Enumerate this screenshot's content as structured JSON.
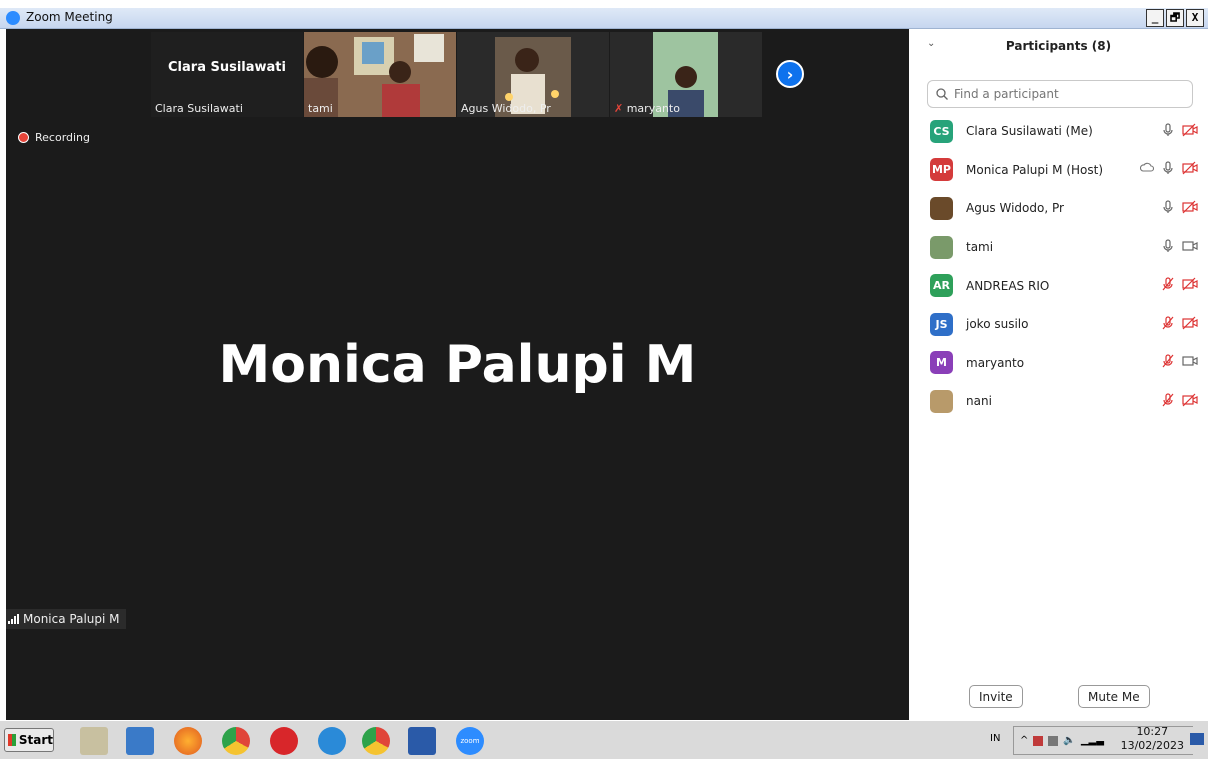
{
  "window": {
    "title": "Zoom Meeting",
    "minimize": "_",
    "restore": "🗗",
    "close": "X"
  },
  "strip": {
    "speaker": "Clara Susilawati",
    "tiles": [
      {
        "label": "Clara Susilawati"
      },
      {
        "label": "tami"
      },
      {
        "label": "Agus Widodo, Pr"
      },
      {
        "label": "maryanto"
      }
    ]
  },
  "recording": "Recording",
  "main_speaker": "Monica Palupi M",
  "bottom_name": "Monica Palupi M",
  "participants": {
    "title": "Participants (8)",
    "search_placeholder": "Find a participant",
    "list": [
      {
        "initials": "CS",
        "name": "Clara Susilawati (Me)",
        "color": "#27a37a",
        "mic": "on",
        "video": "off"
      },
      {
        "initials": "MP",
        "name": "Monica Palupi M (Host)",
        "color": "#d43b3b",
        "mic": "on",
        "video": "off",
        "sharing": true
      },
      {
        "initials": "",
        "name": "Agus Widodo, Pr",
        "color": "#6a4a2a",
        "mic": "on",
        "video": "off"
      },
      {
        "initials": "",
        "name": "tami",
        "color": "#7a9a6a",
        "mic": "on",
        "video": "on"
      },
      {
        "initials": "AR",
        "name": "ANDREAS RIO",
        "color": "#2ea05a",
        "mic": "off",
        "video": "off"
      },
      {
        "initials": "JS",
        "name": "joko susilo",
        "color": "#2f6fc8",
        "mic": "off",
        "video": "off"
      },
      {
        "initials": "M",
        "name": "maryanto",
        "color": "#8a3fb8",
        "mic": "off",
        "video": "on"
      },
      {
        "initials": "",
        "name": "nani",
        "color": "#b89a6a",
        "mic": "off",
        "video": "off"
      }
    ],
    "invite": "Invite",
    "mute_me": "Mute Me"
  },
  "taskbar": {
    "start": "Start",
    "lang": "IN",
    "time": "10:27",
    "date": "13/02/2023",
    "zoom_label": "zoom"
  }
}
